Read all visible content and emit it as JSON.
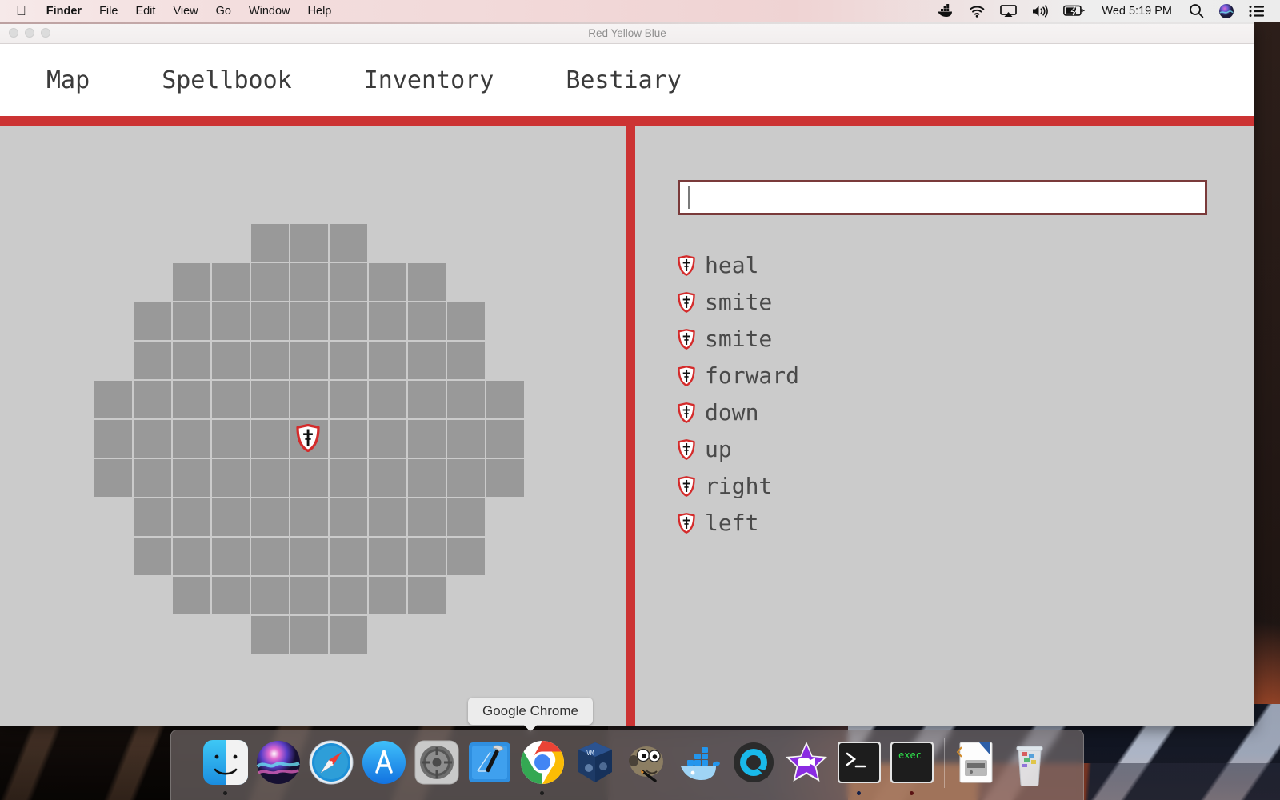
{
  "menubar": {
    "apple_icon": "apple-logo",
    "items": [
      {
        "label": "Finder",
        "bold": true
      },
      {
        "label": "File",
        "bold": false
      },
      {
        "label": "Edit",
        "bold": false
      },
      {
        "label": "View",
        "bold": false
      },
      {
        "label": "Go",
        "bold": false
      },
      {
        "label": "Window",
        "bold": false
      },
      {
        "label": "Help",
        "bold": false
      }
    ],
    "status_icons": [
      "docker-icon",
      "wifi-icon",
      "airplay-icon",
      "volume-icon",
      "battery-charging-icon"
    ],
    "clock": "Wed 5:19 PM",
    "right_icons": [
      "search-icon",
      "siri-icon",
      "notification-center-icon"
    ]
  },
  "window": {
    "title": "Red Yellow Blue",
    "traffic_lights": [
      "close-button",
      "minimize-button",
      "zoom-button"
    ]
  },
  "nav": {
    "tabs": [
      {
        "label": "Map"
      },
      {
        "label": "Spellbook"
      },
      {
        "label": "Inventory"
      },
      {
        "label": "Bestiary"
      }
    ],
    "rule_color": "#cc3333"
  },
  "map": {
    "tile_color": "#999999",
    "background_color": "#cbcbcb",
    "columns": 11,
    "player": {
      "row": 5,
      "col": 5,
      "icon": "shield-sword-icon"
    },
    "rows": [
      [
        0,
        0,
        0,
        0,
        1,
        1,
        1,
        0,
        0,
        0,
        0
      ],
      [
        0,
        0,
        1,
        1,
        1,
        1,
        1,
        1,
        1,
        0,
        0
      ],
      [
        0,
        1,
        1,
        1,
        1,
        1,
        1,
        1,
        1,
        1,
        0
      ],
      [
        0,
        1,
        1,
        1,
        1,
        1,
        1,
        1,
        1,
        1,
        0
      ],
      [
        1,
        1,
        1,
        1,
        1,
        1,
        1,
        1,
        1,
        1,
        1
      ],
      [
        1,
        1,
        1,
        1,
        1,
        1,
        1,
        1,
        1,
        1,
        1
      ],
      [
        1,
        1,
        1,
        1,
        1,
        1,
        1,
        1,
        1,
        1,
        1
      ],
      [
        0,
        1,
        1,
        1,
        1,
        1,
        1,
        1,
        1,
        1,
        0
      ],
      [
        0,
        1,
        1,
        1,
        1,
        1,
        1,
        1,
        1,
        1,
        0
      ],
      [
        0,
        0,
        1,
        1,
        1,
        1,
        1,
        1,
        1,
        0,
        0
      ],
      [
        0,
        0,
        0,
        0,
        1,
        1,
        1,
        0,
        0,
        0,
        0
      ]
    ]
  },
  "spellbook": {
    "input": {
      "value": "",
      "placeholder": ""
    },
    "spells": [
      {
        "label": "heal",
        "icon": "shield-sword-icon"
      },
      {
        "label": "smite",
        "icon": "shield-sword-icon"
      },
      {
        "label": "smite",
        "icon": "shield-sword-icon"
      },
      {
        "label": "forward",
        "icon": "shield-sword-icon"
      },
      {
        "label": "down",
        "icon": "shield-sword-icon"
      },
      {
        "label": "up",
        "icon": "shield-sword-icon"
      },
      {
        "label": "right",
        "icon": "shield-sword-icon"
      },
      {
        "label": "left",
        "icon": "shield-sword-icon"
      }
    ]
  },
  "tooltip": {
    "text": "Google Chrome"
  },
  "dock": {
    "items": [
      {
        "name": "finder",
        "running": true
      },
      {
        "name": "siri",
        "running": false
      },
      {
        "name": "safari",
        "running": false
      },
      {
        "name": "app-store",
        "running": false
      },
      {
        "name": "system-preferences",
        "running": false
      },
      {
        "name": "xcode",
        "running": false
      },
      {
        "name": "google-chrome",
        "running": true
      },
      {
        "name": "virtualbox",
        "running": false
      },
      {
        "name": "gimp",
        "running": false
      },
      {
        "name": "docker",
        "running": false
      },
      {
        "name": "quicktime",
        "running": false
      },
      {
        "name": "imovie",
        "running": false
      },
      {
        "name": "terminal",
        "running": true
      },
      {
        "name": "iterm-exec",
        "running": true
      }
    ],
    "right_items": [
      {
        "name": "downloads-stack"
      },
      {
        "name": "trash"
      }
    ],
    "terminal_label": ">_",
    "iterm_label": "exec"
  },
  "colors": {
    "accent_red": "#cc3333",
    "input_border": "#7a3a3a",
    "tile": "#999999",
    "pane_bg": "#cbcbcb"
  }
}
